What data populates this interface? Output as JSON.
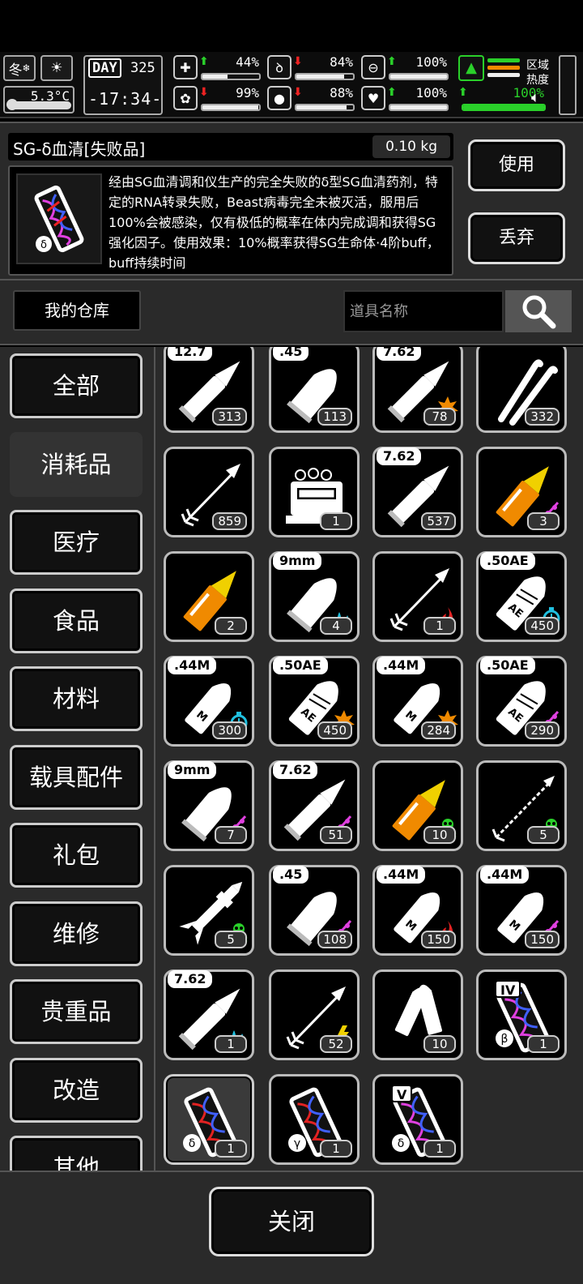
{
  "status": {
    "season": "冬",
    "temperature": "5.3°C",
    "day_label": "DAY",
    "day_number": "325",
    "time": "-17:34-",
    "stats": [
      {
        "icon": "medkit-icon",
        "arrow": "up",
        "value": "44%",
        "level": 0.44
      },
      {
        "icon": "stomach-icon",
        "arrow": "down",
        "value": "84%",
        "level": 0.84
      },
      {
        "icon": "bladder-icon",
        "arrow": "up",
        "value": "100%",
        "level": 1.0
      },
      {
        "icon": "brain-icon",
        "arrow": "down",
        "value": "99%",
        "level": 0.99
      },
      {
        "icon": "water-drop-icon",
        "arrow": "down",
        "value": "88%",
        "level": 0.88
      },
      {
        "icon": "heart-icon",
        "arrow": "up",
        "value": "100%",
        "level": 1.0
      },
      {
        "icon": "leg-icon",
        "arrow": "up",
        "value": "100%",
        "level": 1.0
      }
    ],
    "area_label_1": "区域",
    "area_label_2": "热度"
  },
  "detail": {
    "item_name": "SG-δ血清[失败品]",
    "weight": "0.10 kg",
    "description": "经由SG血清调和仪生产的完全失败的δ型SG血清药剂，特定的RNA转录失败，Beast病毒完全未被灭活，服用后100%会被感染，仅有极低的概率在体内完成调和获得SG强化因子。使用效果：10%概率获得SG生命体·4阶buff，buff持续时间",
    "use_label": "使用",
    "discard_label": "丢弃"
  },
  "warehouse": {
    "button_label": "我的仓库",
    "search_placeholder": "道具名称"
  },
  "categories": [
    "全部",
    "消耗品",
    "医疗",
    "食品",
    "材料",
    "载具配件",
    "礼包",
    "维修",
    "贵重品",
    "改造",
    "其他"
  ],
  "active_category": 1,
  "items": [
    {
      "label": "12.7",
      "count": "313",
      "kind": "rifle-bullet",
      "mark": ""
    },
    {
      "label": ".45",
      "count": "113",
      "kind": "pistol-bullet",
      "mark": ""
    },
    {
      "label": "7.62",
      "count": "78",
      "kind": "rifle-bullet",
      "mark": "explosive"
    },
    {
      "label": "",
      "count": "332",
      "kind": "tools",
      "mark": ""
    },
    {
      "label": "",
      "count": "859",
      "kind": "arrow",
      "mark": ""
    },
    {
      "label": "",
      "count": "1",
      "kind": "machine",
      "mark": ""
    },
    {
      "label": "7.62",
      "count": "537",
      "kind": "rifle-bullet",
      "mark": ""
    },
    {
      "label": "",
      "count": "3",
      "kind": "shell",
      "mark": "magenta"
    },
    {
      "label": "",
      "count": "2",
      "kind": "shell",
      "mark": ""
    },
    {
      "label": "9mm",
      "count": "4",
      "kind": "pistol-bullet",
      "mark": "water"
    },
    {
      "label": "",
      "count": "1",
      "kind": "arrow",
      "mark": "fire"
    },
    {
      "label": ".50AE",
      "count": "450",
      "kind": "ae-bullet",
      "mark": "freeze"
    },
    {
      "label": ".44M",
      "count": "300",
      "kind": "m-bullet",
      "mark": "freeze"
    },
    {
      "label": ".50AE",
      "count": "450",
      "kind": "ae-bullet",
      "mark": "explosive"
    },
    {
      "label": ".44M",
      "count": "284",
      "kind": "m-bullet",
      "mark": "explosive"
    },
    {
      "label": ".50AE",
      "count": "290",
      "kind": "ae-bullet",
      "mark": "magenta"
    },
    {
      "label": "9mm",
      "count": "7",
      "kind": "pistol-bullet",
      "mark": "magenta"
    },
    {
      "label": "7.62",
      "count": "51",
      "kind": "rifle-bullet",
      "mark": "magenta"
    },
    {
      "label": "",
      "count": "10",
      "kind": "shell",
      "mark": "poison"
    },
    {
      "label": "",
      "count": "5",
      "kind": "spear",
      "mark": "poison"
    },
    {
      "label": "",
      "count": "5",
      "kind": "rocket",
      "mark": "poison"
    },
    {
      "label": ".45",
      "count": "108",
      "kind": "pistol-bullet",
      "mark": "magenta"
    },
    {
      "label": ".44M",
      "count": "150",
      "kind": "m-bullet",
      "mark": "fire"
    },
    {
      "label": ".44M",
      "count": "150",
      "kind": "m-bullet",
      "mark": "magenta"
    },
    {
      "label": "7.62",
      "count": "1",
      "kind": "rifle-bullet",
      "mark": "water"
    },
    {
      "label": "",
      "count": "52",
      "kind": "arrow",
      "mark": "electric"
    },
    {
      "label": "",
      "count": "10",
      "kind": "shotgun",
      "mark": ""
    },
    {
      "label": "IV",
      "count": "1",
      "kind": "serum",
      "mark": "β"
    },
    {
      "label": "",
      "count": "1",
      "kind": "serum-bad",
      "mark": "δ"
    },
    {
      "label": "",
      "count": "1",
      "kind": "serum-bad",
      "mark": "γ"
    },
    {
      "label": "V",
      "count": "1",
      "kind": "serum",
      "mark": "δ"
    }
  ],
  "selected_item": 28,
  "close_label": "关闭",
  "colors": {
    "green": "#2ad02a",
    "red": "#e22222",
    "magenta": "#e040e0",
    "cyan": "#20c0e0",
    "orange": "#f08a00",
    "yellow": "#f0d000"
  }
}
